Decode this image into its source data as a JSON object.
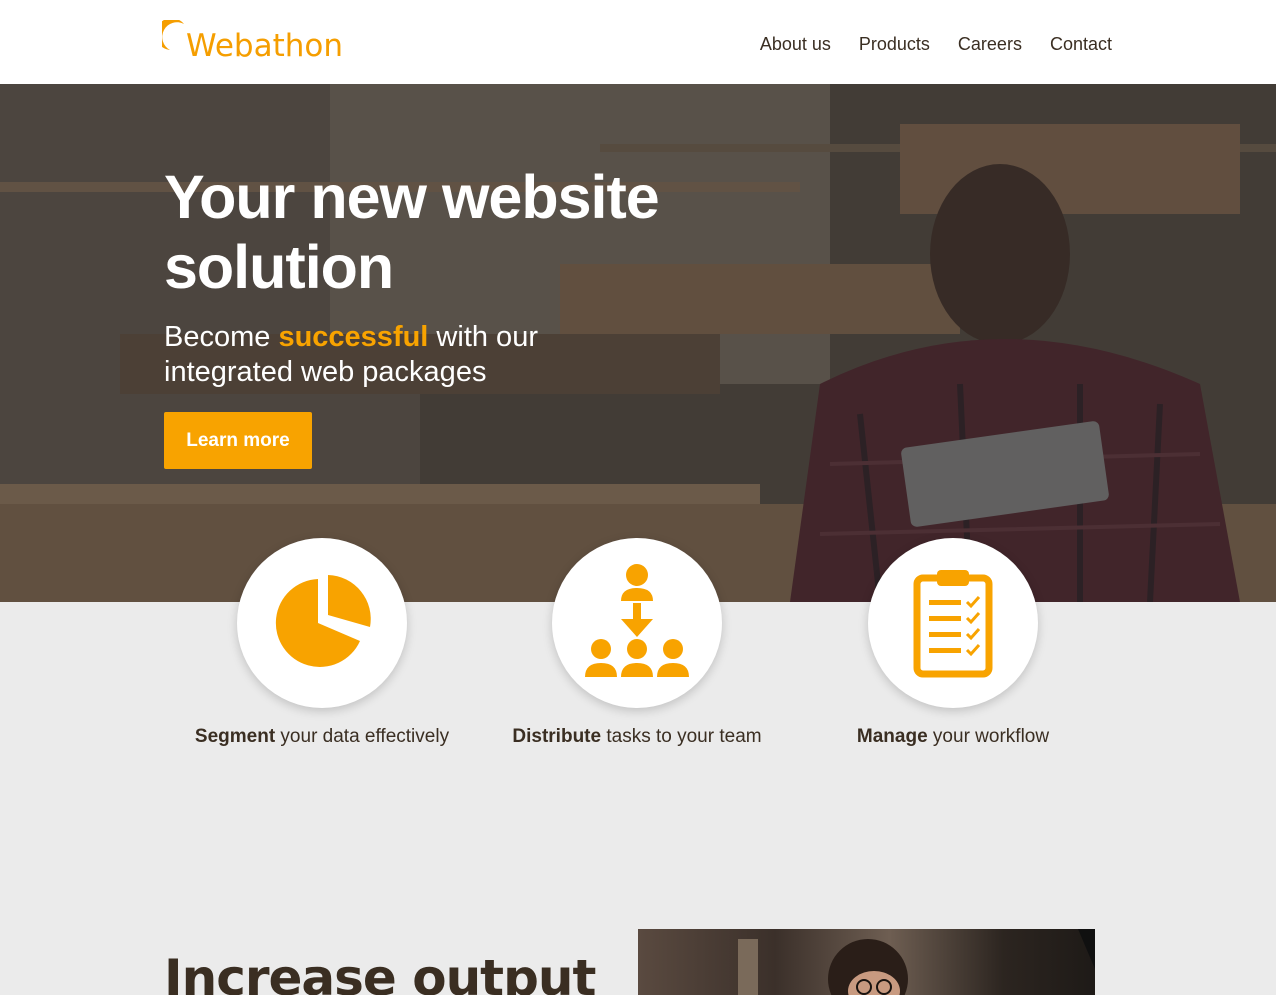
{
  "header": {
    "brand": "Webathon",
    "nav": [
      "About us",
      "Products",
      "Careers",
      "Contact"
    ]
  },
  "hero": {
    "title": "Your new website solution",
    "subtitle_before": "Become ",
    "subtitle_highlight": "successful",
    "subtitle_after": " with our integrated web packages",
    "cta_label": "Learn more"
  },
  "features": [
    {
      "icon": "pie-chart-icon",
      "bold": "Segment",
      "rest": " your data effectively"
    },
    {
      "icon": "team-distribution-icon",
      "bold": "Distribute",
      "rest": " tasks to your team"
    },
    {
      "icon": "clipboard-checklist-icon",
      "bold": "Manage",
      "rest": " your workflow"
    }
  ],
  "section2": {
    "title": "Increase output"
  },
  "colors": {
    "accent": "#f8a300",
    "text_dark": "#3a2e22",
    "background": "#ebebeb"
  }
}
